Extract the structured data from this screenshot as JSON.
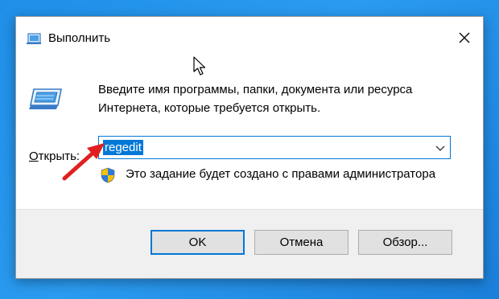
{
  "window": {
    "title": "Выполнить"
  },
  "dialog": {
    "description_line1": "Введите имя программы, папки, документа или ресурса",
    "description_line2": "Интернета, которые требуется открыть.",
    "open_label_accel": "О",
    "open_label_rest": "ткрыть:",
    "input_value": "regedit",
    "admin_note": "Это задание будет создано с правами администратора"
  },
  "buttons": {
    "ok": "OK",
    "cancel": "Отмена",
    "browse": "Обзор..."
  },
  "icons": {
    "title": "run-icon",
    "main": "run-icon",
    "shield": "uac-shield-icon",
    "close": "close-icon",
    "dropdown": "chevron-down-icon",
    "annotation": "red-arrow",
    "cursor": "mouse-pointer-icon"
  },
  "colors": {
    "desktop": "#1f8fe8",
    "accent": "#0078d7",
    "annotation": "#e02020"
  }
}
